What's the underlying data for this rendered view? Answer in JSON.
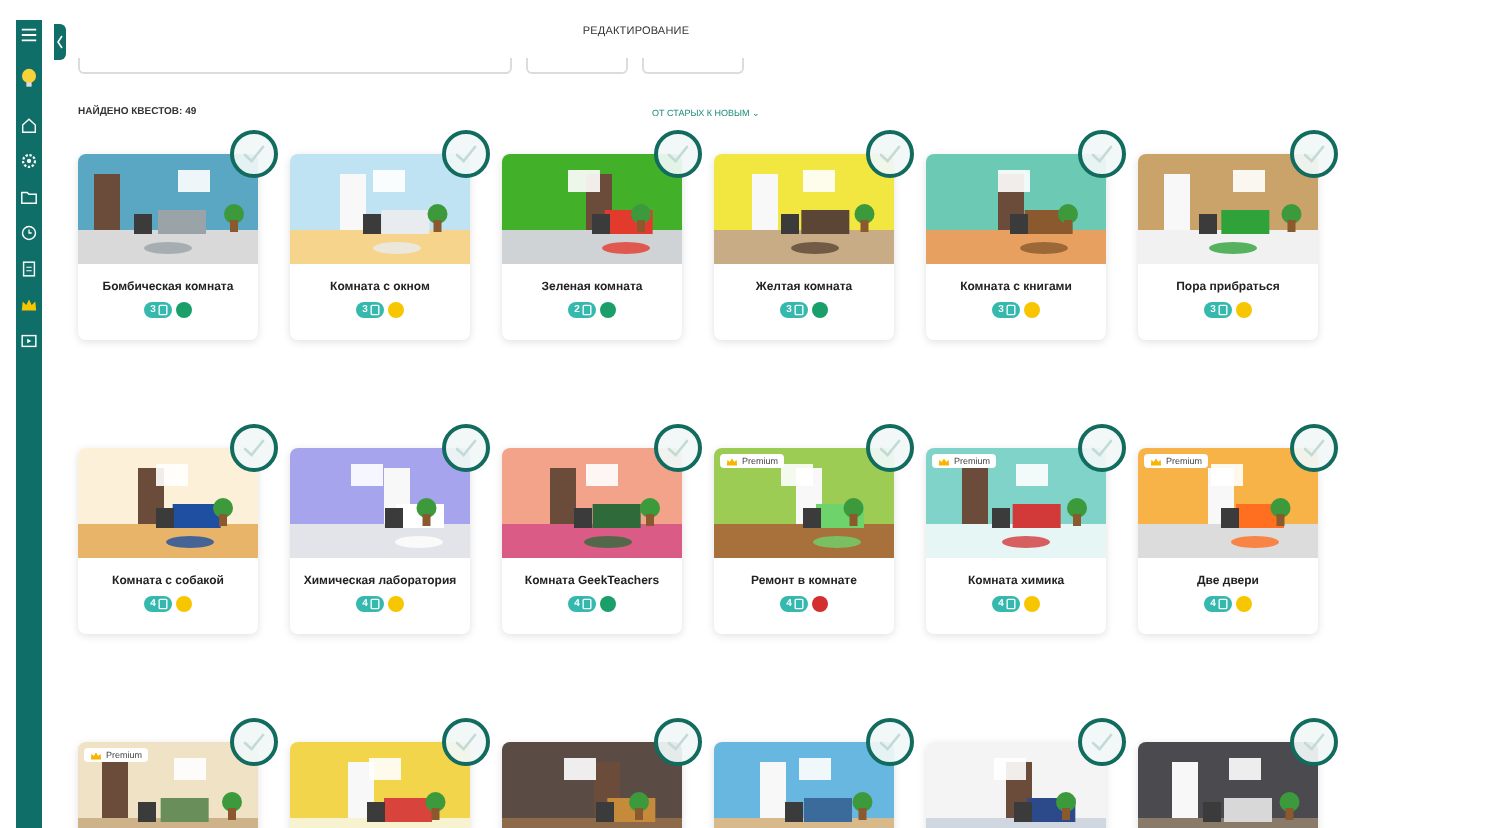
{
  "header": {
    "title": "РЕДАКТИРОВАНИЕ"
  },
  "summary": {
    "found": "НАЙДЕНО КВЕСТОВ: 49",
    "sort": "ОТ СТАРЫХ К НОВЫМ ⌄"
  },
  "quests": [
    {
      "title": "Бомбическая комната",
      "count": "3",
      "color": "#1a9e6a",
      "checked": false
    },
    {
      "title": "Комната с окном",
      "count": "3",
      "color": "#f7c600",
      "checked": false
    },
    {
      "title": "Зеленая комната",
      "count": "2",
      "color": "#1a9e6a",
      "checked": false
    },
    {
      "title": "Желтая комната",
      "count": "3",
      "color": "#1a9e6a",
      "checked": false
    },
    {
      "title": "Комната с книгами",
      "count": "3",
      "color": "#f7c600",
      "checked": false
    },
    {
      "title": "Пора прибраться",
      "count": "3",
      "color": "#f7c600",
      "checked": false
    },
    {
      "title": "Комната с собакой",
      "count": "4",
      "color": "#f7c600",
      "checked": false
    },
    {
      "title": "Химическая лаборатория",
      "count": "4",
      "color": "#f7c600",
      "checked": false
    },
    {
      "title": "Комната GeekTeachers",
      "count": "4",
      "color": "#1a9e6a",
      "checked": false
    },
    {
      "title": "Ремонт в комнате",
      "count": "4",
      "color": "#d32f2f",
      "checked": false,
      "badge": "Premium"
    },
    {
      "title": "Комната химика",
      "count": "4",
      "color": "#f7c600",
      "checked": false,
      "badge": "Premium"
    },
    {
      "title": "Две двери",
      "count": "4",
      "color": "#f7c600",
      "checked": false,
      "badge": "Premium"
    },
    {
      "checked": false,
      "badge": "Premium"
    },
    {
      "checked": false
    },
    {
      "checked": false
    },
    {
      "checked": false
    },
    {
      "checked": false
    },
    {
      "checked": false
    }
  ]
}
